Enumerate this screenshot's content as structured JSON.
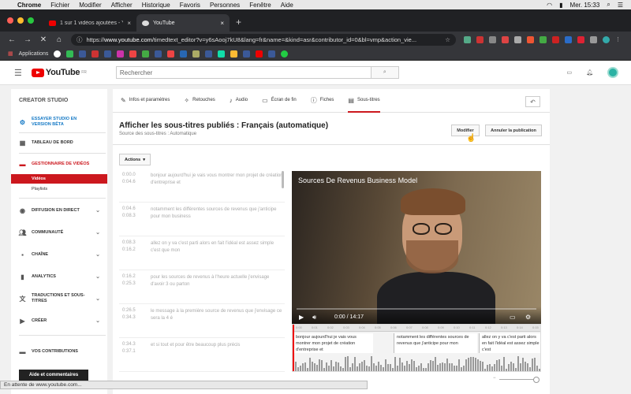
{
  "macbar": {
    "apple": "",
    "app": "Chrome",
    "menus": [
      "Fichier",
      "Modifier",
      "Afficher",
      "Historique",
      "Favoris",
      "Personnes",
      "Fenêtre",
      "Aide"
    ],
    "clock": "Mer. 15:33"
  },
  "browser": {
    "tabs": [
      {
        "title": "1 sur 1 vidéos ajoutées - YouTu",
        "fav_color": "#e00"
      },
      {
        "title": "YouTube",
        "fav_color": "#ddd"
      }
    ],
    "url_prefix": "https://",
    "url_host": "www.youtube.com",
    "url_path": "/timedtext_editor?v=y6sAooj7kU8&lang=fr&name=&kind=asr&contributor_id=0&bl=vmp&action_vie...",
    "bookmarks_label": "Applications",
    "status": "En attente de www.youtube.com..."
  },
  "youtube": {
    "logo": "YouTube",
    "region": "FR",
    "search_placeholder": "Rechercher"
  },
  "sidebar": {
    "studio": "CREATOR STUDIO",
    "beta": "ESSAYER STUDIO EN VERSION BÊTA",
    "dashboard": "TABLEAU DE BORD",
    "video_manager": "GESTIONNAIRE DE VIDÉOS",
    "sub_videos": "Vidéos",
    "sub_playlists": "Playlists",
    "live": "DIFFUSION EN DIRECT",
    "community": "COMMUNAUTÉ",
    "channel": "CHAÎNE",
    "analytics": "ANALYTICS",
    "translations": "TRADUCTIONS ET SOUS-TITRES",
    "create": "CRÉER",
    "contributions": "VOS CONTRIBUTIONS",
    "help": "Aide et commentaires"
  },
  "editor": {
    "tabs": [
      "Infos et paramètres",
      "Retouches",
      "Audio",
      "Écran de fin",
      "Fiches",
      "Sous-titres"
    ],
    "title": "Afficher les sous-titres publiés : Français (automatique)",
    "subtitle": "Source des sous-titres : Automatique",
    "edit_button": "Modifier",
    "unpublish_button": "Annuler la publication",
    "actions_button": "Actions",
    "cues": [
      {
        "start": "0:00.0",
        "end": "0:04.6",
        "text": "bonjour aujourd'hui je vais vous montrer mon projet de création d'entreprise et"
      },
      {
        "start": "0:04.6",
        "end": "0:08.3",
        "text": "notamment les différentes sources de revenus que j'anticipe pour mon business"
      },
      {
        "start": "0:08.3",
        "end": "0:16.2",
        "text": "allez on y va c'est parti alors en fait l'idéal est assez simple c'est que mon"
      },
      {
        "start": "0:16.2",
        "end": "0:25.3",
        "text": "pour les sources de revenus à l'heure actuelle j'envisage d'avoir 3 ou parton"
      },
      {
        "start": "0:26.5",
        "end": "0:34.3",
        "text": "le message à la première source de revenus que j'envisage ce sera la 4 é"
      },
      {
        "start": "0:34.3",
        "end": "0:37.1",
        "text": "et si tout et pour être beaucoup plus précis"
      }
    ],
    "video_title": "Sources De Revenus Business Model",
    "video_time": "0:00 / 14:17",
    "video_progress": 0,
    "timeline_ticks": [
      "0:00",
      "0:01",
      "0:02",
      "0:03",
      "0:04",
      "0:05",
      "0:06",
      "0:07",
      "0:08",
      "0:09",
      "0:10",
      "0:11",
      "0:12",
      "0:13",
      "0:14",
      "0:15"
    ],
    "timeline_caps": [
      "bonjour aujourd'hui je vais vous montrer mon projet de création d'entreprise et",
      "notamment les différentes sources de revenus que j'anticipe pour mon",
      "allez on y va c'est parti alors en fait l'idéal est assez simple c'est"
    ]
  }
}
